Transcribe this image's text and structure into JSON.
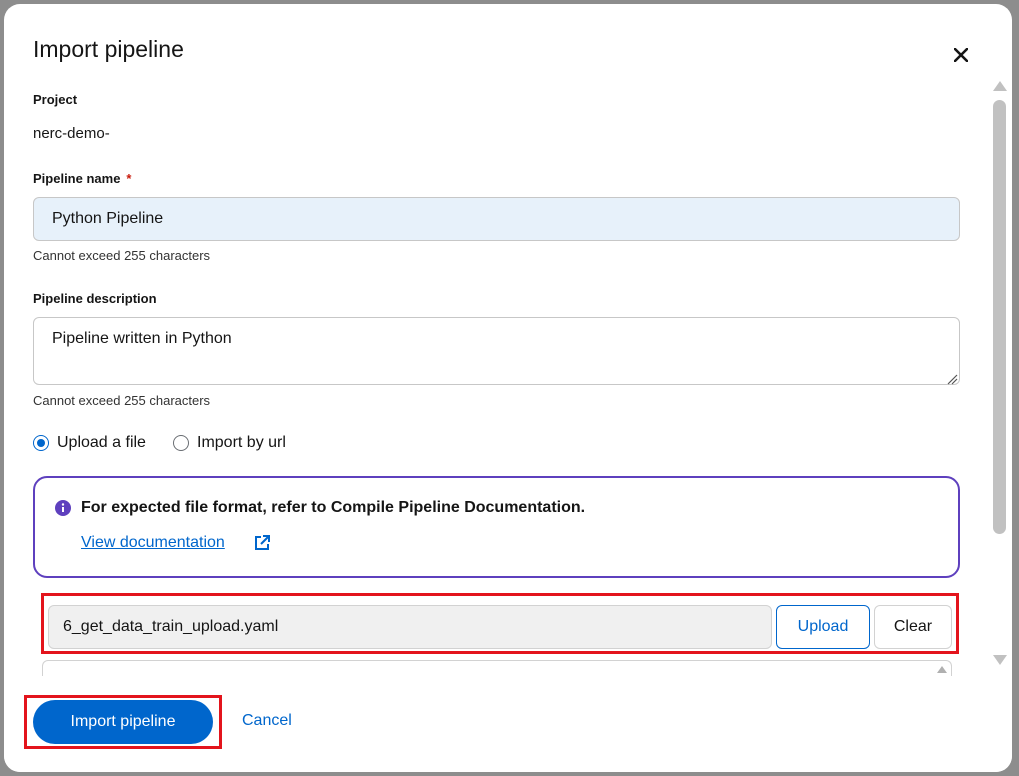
{
  "modal": {
    "title": "Import pipeline",
    "close_icon": "close-icon"
  },
  "form": {
    "project": {
      "label": "Project",
      "value": "nerc-demo-"
    },
    "pipeline_name": {
      "label": "Pipeline name",
      "required_mark": "*",
      "value": "Python Pipeline",
      "helper": "Cannot exceed 255 characters"
    },
    "pipeline_description": {
      "label": "Pipeline description",
      "value": "Pipeline written in Python",
      "helper": "Cannot exceed 255 characters"
    },
    "source": {
      "options": [
        {
          "label": "Upload a file",
          "checked": true
        },
        {
          "label": "Import by url",
          "checked": false
        }
      ]
    },
    "alert": {
      "icon": "info-icon",
      "title": "For expected file format, refer to Compile Pipeline Documentation.",
      "link_label": "View documentation",
      "link_icon": "external-link-icon",
      "border_color": "#5e40be"
    },
    "file_upload": {
      "filename": "6_get_data_train_upload.yaml",
      "upload_label": "Upload",
      "clear_label": "Clear"
    }
  },
  "footer": {
    "primary_label": "Import pipeline",
    "cancel_label": "Cancel"
  },
  "colors": {
    "primary": "#0066cc",
    "highlight": "#e3141c",
    "input_bg": "#e7f1fa"
  }
}
